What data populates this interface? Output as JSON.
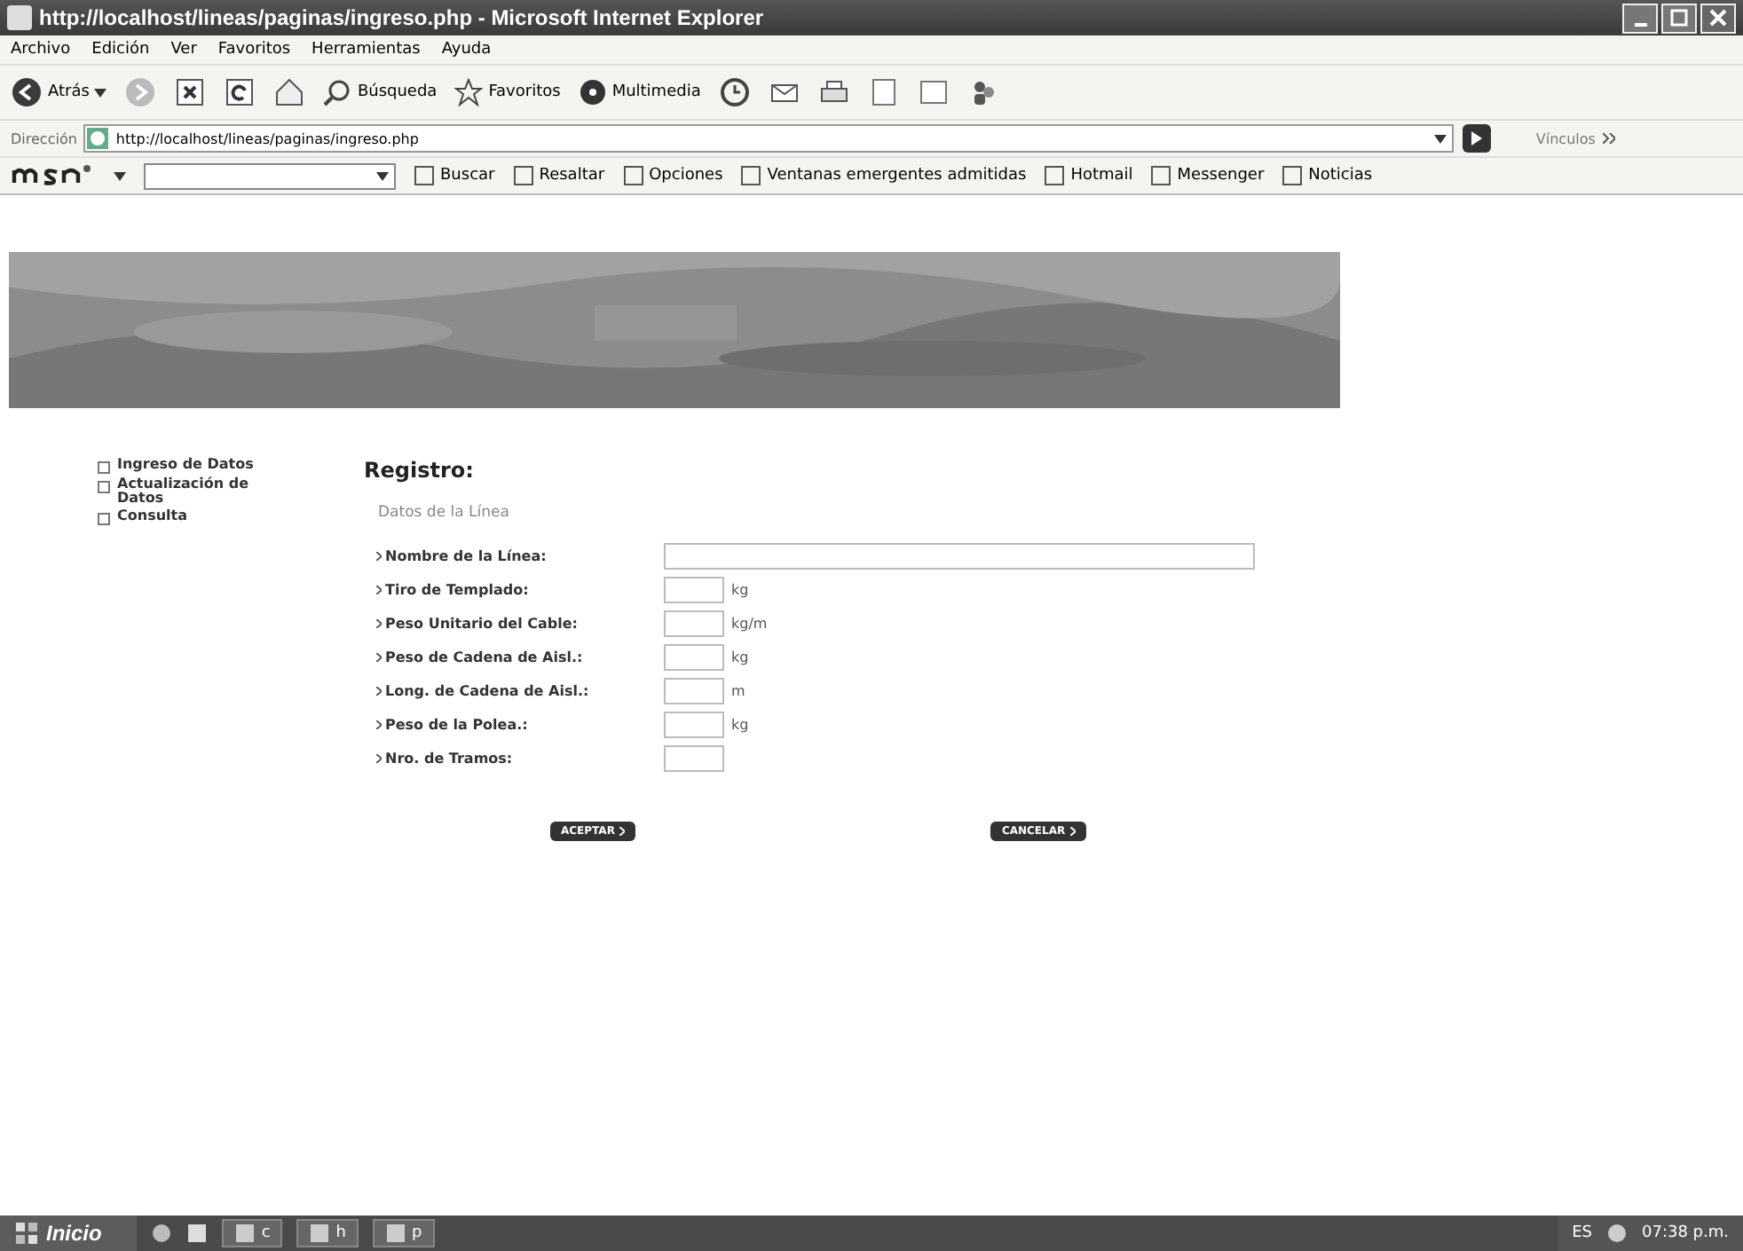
{
  "window": {
    "title": "http://localhost/lineas/paginas/ingreso.php - Microsoft Internet Explorer"
  },
  "menu": [
    "Archivo",
    "Edición",
    "Ver",
    "Favoritos",
    "Herramientas",
    "Ayuda"
  ],
  "toolbar": {
    "back": "Atrás",
    "search": "Búsqueda",
    "favorites": "Favoritos",
    "media": "Multimedia"
  },
  "address": {
    "label": "Dirección",
    "value": "http://localhost/lineas/paginas/ingreso.php",
    "links": "Vínculos"
  },
  "msn_bar": {
    "buttons": [
      "Buscar",
      "Resaltar",
      "Opciones",
      "Ventanas emergentes admitidas",
      "Hotmail",
      "Messenger",
      "Noticias"
    ]
  },
  "sidebar": {
    "items": [
      {
        "label": "Ingreso de Datos"
      },
      {
        "label": "Actualización de Datos"
      },
      {
        "label": "Consulta"
      }
    ]
  },
  "form": {
    "title": "Registro:",
    "section": "Datos de la Línea",
    "fields": [
      {
        "label": "Nombre de la Línea:",
        "kind": "wide"
      },
      {
        "label": "Tiro de Templado:",
        "kind": "unit",
        "unit": "kg"
      },
      {
        "label": "Peso Unitario del Cable:",
        "kind": "unit",
        "unit": "kg/m"
      },
      {
        "label": "Peso de Cadena de Aisl.:",
        "kind": "unit",
        "unit": "kg"
      },
      {
        "label": "Long. de Cadena de Aisl.:",
        "kind": "unit",
        "unit": "m"
      },
      {
        "label": "Peso de la Polea.:",
        "kind": "unit",
        "unit": "kg"
      },
      {
        "label": "Nro. de Tramos:",
        "kind": "short"
      }
    ],
    "buttons": [
      "ACEPTAR",
      "CANCELAR"
    ]
  },
  "taskbar": {
    "start": "Inicio",
    "tasks": [
      "c",
      "h",
      "p"
    ],
    "language": "ES",
    "clock": "07:38 p.m."
  }
}
